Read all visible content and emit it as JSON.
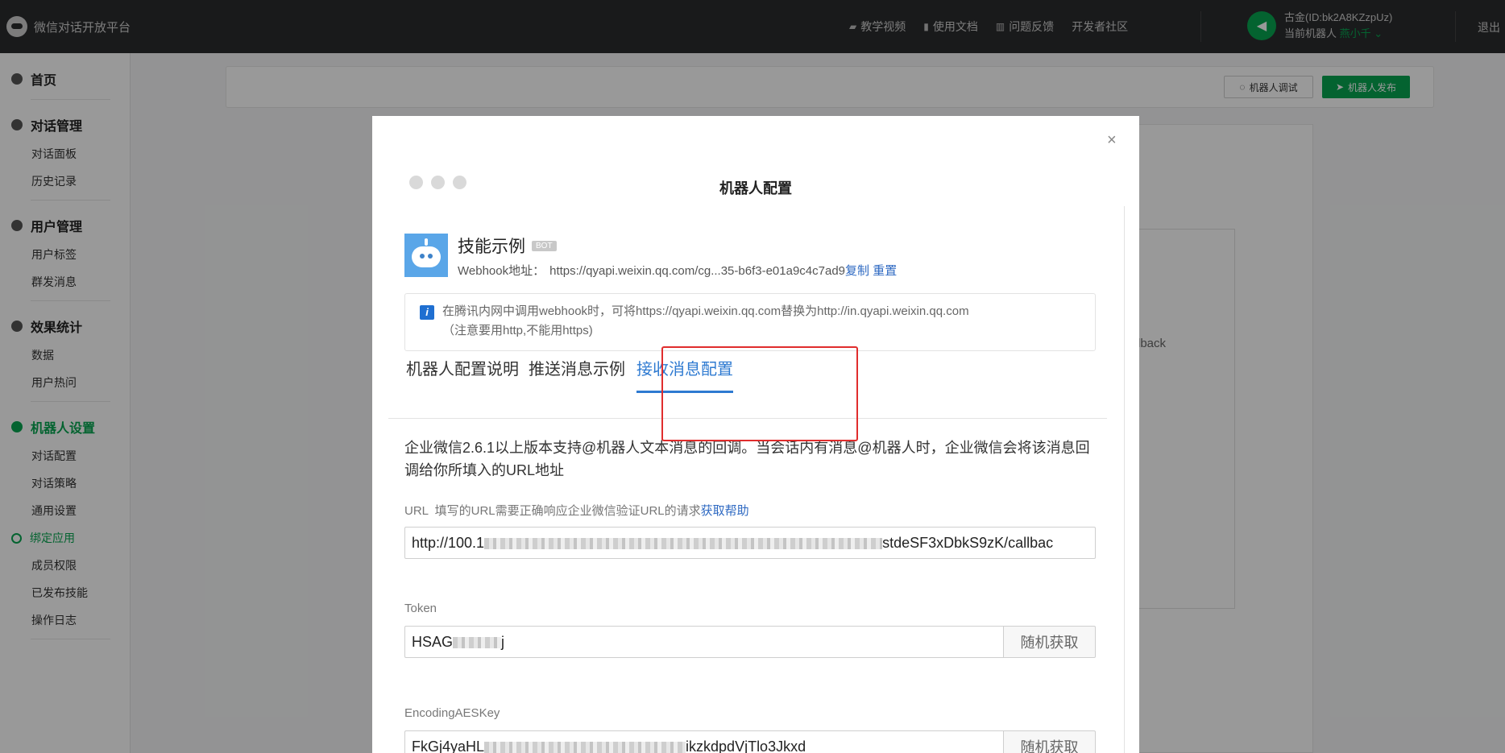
{
  "topbar": {
    "brand": "微信对话开放平台",
    "links": [
      {
        "icon": "video-icon",
        "label": "教学视频"
      },
      {
        "icon": "document-icon",
        "label": "使用文档"
      },
      {
        "icon": "feedback-icon",
        "label": "问题反馈"
      },
      {
        "icon": "grid-icon",
        "label": "开发者社区"
      }
    ],
    "account_name": "古金(ID:bk2A8KZzpUz)",
    "current_bot_label": "当前机器人",
    "current_bot_name": "燕小千",
    "logout": "退出"
  },
  "sidebar": {
    "home": "首页",
    "groups": [
      {
        "title": "对话管理",
        "items": [
          "对话面板",
          "历史记录"
        ]
      },
      {
        "title": "用户管理",
        "items": [
          "用户标签",
          "群发消息"
        ]
      },
      {
        "title": "效果统计",
        "items": [
          "数据",
          "用户热问"
        ]
      },
      {
        "title": "机器人设置",
        "items": [
          "对话配置",
          "对话策略",
          "通用设置",
          "绑定应用",
          "成员权限",
          "已发布技能",
          "操作日志"
        ]
      }
    ]
  },
  "main": {
    "debug_button": "机器人调试",
    "publish_button": "机器人发布",
    "bg_fragment": "lback"
  },
  "modal": {
    "title": "机器人配置",
    "bot_name": "技能示例",
    "bot_badge": "BOT",
    "webhook_label": "Webhook地址：",
    "webhook_url": "https://qyapi.weixin.qq.com/cg...35-b6f3-e01a9c4c7ad9",
    "copy_link": "复制",
    "reset_link": "重置",
    "notice_line1": "在腾讯内网中调用webhook时，可将https://qyapi.weixin.qq.com替换为http://in.qyapi.weixin.qq.com",
    "notice_line2": "（注意要用http,不能用https)",
    "tabs": [
      "机器人配置说明",
      "推送消息示例",
      "接收消息配置"
    ],
    "active_tab": 2,
    "description": "企业微信2.6.1以上版本支持@机器人文本消息的回调。当会话内有消息@机器人时，企业微信会将该消息回调给你所填入的URL地址",
    "url_label": "URL",
    "url_note": "填写的URL需要正确响应企业微信验证URL的请求",
    "url_help": "获取帮助",
    "url_value_start": "http://100.1",
    "url_value_end": "stdeSF3xDbkS9zK/callbac",
    "token_label": "Token",
    "token_value_start": "HSAG",
    "token_value_end": "j",
    "random_button": "随机获取",
    "aes_label": "EncodingAESKey",
    "aes_value_start": "FkGj4yaHL",
    "aes_value_end": "ikzkdpdVjTlo3Jkxd"
  },
  "colors": {
    "accent_green": "#07a651",
    "link_blue": "#2e69c2",
    "highlight_red": "#e02d2d"
  }
}
